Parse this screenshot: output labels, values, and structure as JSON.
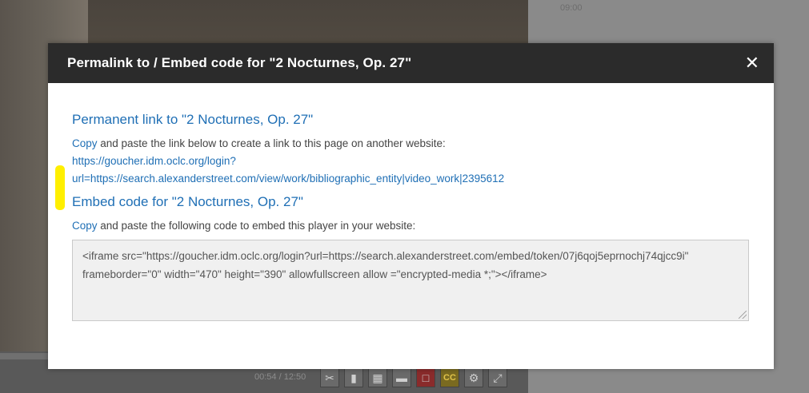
{
  "background": {
    "right_panel_time": "09:00",
    "player_time": "00:54 / 12:50",
    "player_icons": [
      "scissors-icon",
      "bookmark-icon",
      "grid-icon",
      "layout-icon",
      "red-box-icon",
      "cc-icon",
      "gear-icon",
      "expand-icon"
    ],
    "cc_label": "CC"
  },
  "modal": {
    "title": "Permalink to / Embed code for \"2 Nocturnes, Op. 27\"",
    "close_label": "✕",
    "permalink_section": {
      "heading": "Permanent link to \"2 Nocturnes, Op. 27\"",
      "copy_label": "Copy",
      "description": " and paste the link below to create a link to this page on another website:",
      "link_line1": "https://goucher.idm.oclc.org/login?",
      "link_line2": "url=https://search.alexanderstreet.com/view/work/bibliographic_entity|video_work|2395612"
    },
    "embed_section": {
      "heading": "Embed code for \"2 Nocturnes, Op. 27\"",
      "copy_label": "Copy",
      "description": " and paste the following code to embed this player in your website:",
      "code": "<iframe src=\"https://goucher.idm.oclc.org/login?url=https://search.alexanderstreet.com/embed/token/07j6qoj5eprnochj74qjcc9i\" frameborder=\"0\" width=\"470\" height=\"390\" allowfullscreen allow =\"encrypted-media *;\"></iframe>"
    }
  },
  "colors": {
    "header_bg": "#2b2b2b",
    "link": "#1f6fb5",
    "highlight": "#ffef00"
  }
}
